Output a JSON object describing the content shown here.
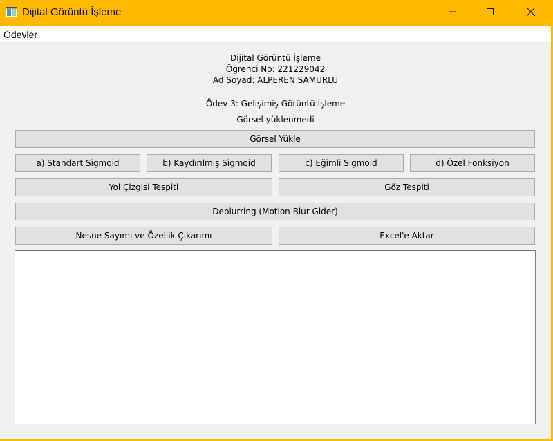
{
  "window": {
    "title": "Dijital Görüntü İşleme",
    "accent_color": "#ffb900",
    "icons": [
      "app-window-icon",
      "minimize-icon",
      "maximize-icon",
      "close-icon"
    ]
  },
  "menubar": {
    "items": [
      {
        "label": "Ödevler"
      }
    ]
  },
  "header": {
    "course": "Dijital Görüntü İşleme",
    "student_no": "Öğrenci No: 221229042",
    "name": "Ad Soyad: ALPEREN SAMURLU",
    "assignment": "Ödev 3: Gelişimiş Görüntü İşleme",
    "status": "Görsel yüklenmedi"
  },
  "buttons": {
    "load_image": "Görsel Yükle",
    "standard_sigmoid": "a) Standart Sigmoid",
    "shifted_sigmoid": "b) Kaydırılmış Sigmoid",
    "sloped_sigmoid": "c) Eğimli Sigmoid",
    "custom_function": "d) Özel Fonksiyon",
    "lane_detection": "Yol Çizgisi Tespiti",
    "eye_detection": "Göz Tespiti",
    "deblurring": "Deblurring (Motion Blur Gider)",
    "object_counting": "Nesne Sayımı ve Özellik Çıkarımı",
    "export_excel": "Excel'e Aktar"
  },
  "output": {
    "text": ""
  }
}
